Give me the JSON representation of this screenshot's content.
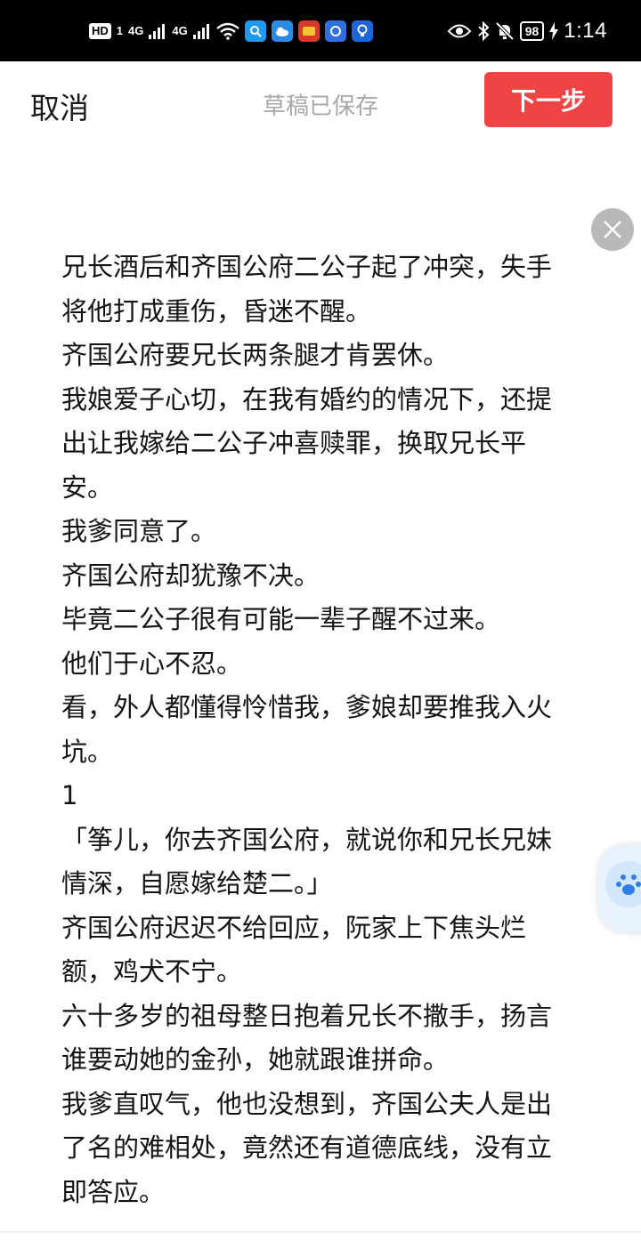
{
  "status_bar": {
    "hd": "HD",
    "sim1": "1",
    "net1": "4G",
    "net2": "4G",
    "battery": "98",
    "time": "1:14"
  },
  "header": {
    "cancel_label": "取消",
    "draft_status": "草稿已保存",
    "next_label": "下一步"
  },
  "colors": {
    "next_button": "#ee4544",
    "status_bar": "#000000",
    "draft_text": "#a8a8a8"
  },
  "editor": {
    "paragraphs": [
      "兄长酒后和齐国公府二公子起了冲突，失手将他打成重伤，昏迷不醒。",
      "齐国公府要兄长两条腿才肯罢休。",
      "我娘爱子心切，在我有婚约的情况下，还提出让我嫁给二公子冲喜赎罪，换取兄长平安。",
      "我爹同意了。",
      "齐国公府却犹豫不决。",
      "毕竟二公子很有可能一辈子醒不过来。",
      "他们于心不忍。",
      "看，外人都懂得怜惜我，爹娘却要推我入火坑。",
      "1",
      "「筝儿，你去齐国公府，就说你和兄长兄妹情深，自愿嫁给楚二。」",
      "齐国公府迟迟不给回应，阮家上下焦头烂额，鸡犬不宁。",
      "六十多岁的祖母整日抱着兄长不撒手，扬言谁要动她的金孙，她就跟谁拼命。",
      "我爹直叹气，他也没想到，齐国公夫人是出了名的难相处，竟然还有道德底线，没有立即答应。"
    ]
  }
}
